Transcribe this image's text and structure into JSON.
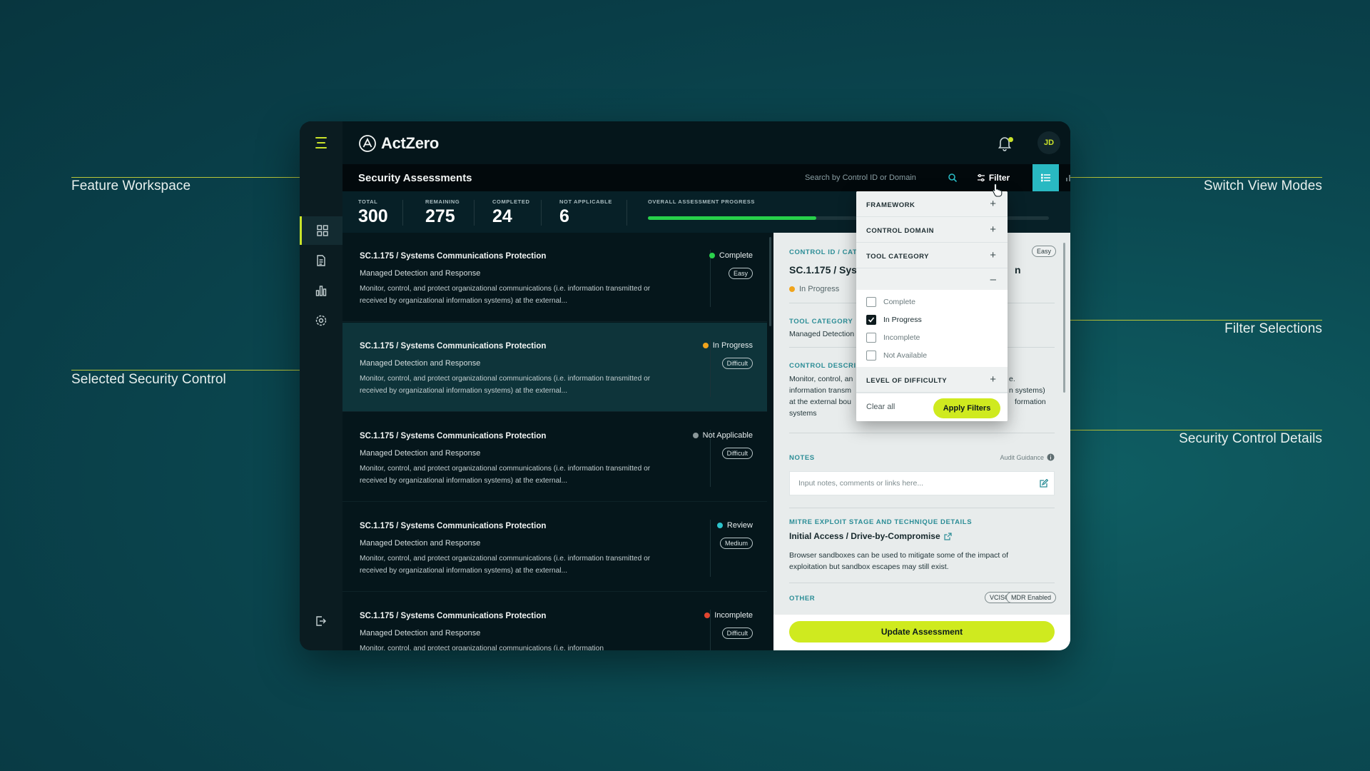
{
  "annotations": {
    "feature_workspace": "Feature Workspace",
    "selected_control": "Selected Security Control",
    "switch_view": "Switch View Modes",
    "filter_selections": "Filter Selections",
    "control_details": "Security Control Details"
  },
  "app": {
    "brand": "ActZero",
    "avatar_initials": "JD",
    "page_title": "Security Assessments",
    "search_placeholder": "Search by Control ID or Domain",
    "filter_label": "Filter"
  },
  "stats": {
    "total": {
      "label": "TOTAL",
      "value": "300"
    },
    "remaining": {
      "label": "REMAINING",
      "value": "275"
    },
    "completed": {
      "label": "COMPLETED",
      "value": "24"
    },
    "not_applicable": {
      "label": "NOT APPLICABLE",
      "value": "6"
    },
    "progress_label": "OVERALL ASSESSMENT PROGRESS",
    "progress_fraction": 0.42
  },
  "controls": [
    {
      "title": "SC.1.175 / Systems Communications Protection",
      "sub": "Managed Detection and Response",
      "desc": "Monitor, control, and protect organizational communications (i.e. information transmitted or received by organizational information systems) at the external...",
      "status": "Complete",
      "status_color": "#2ad24c",
      "difficulty": "Easy"
    },
    {
      "title": "SC.1.175 / Systems Communications Protection",
      "sub": "Managed Detection and Response",
      "desc": "Monitor, control, and protect organizational communications (i.e. information transmitted or received by organizational information systems) at the external...",
      "status": "In Progress",
      "status_color": "#f0a41c",
      "difficulty": "Difficult"
    },
    {
      "title": "SC.1.175 / Systems Communications Protection",
      "sub": "Managed Detection and Response",
      "desc": "Monitor, control, and protect organizational communications (i.e. information transmitted or received by organizational information systems) at the external...",
      "status": "Not Applicable",
      "status_color": "#8a9799",
      "difficulty": "Difficult"
    },
    {
      "title": "SC.1.175 / Systems Communications Protection",
      "sub": "Managed Detection and Response",
      "desc": "Monitor, control, and protect organizational communications (i.e. information transmitted or received by organizational information systems) at the external...",
      "status": "Review",
      "status_color": "#2cc2cb",
      "difficulty": "Medium"
    },
    {
      "title": "SC.1.175 / Systems Communications Protection",
      "sub": "Managed Detection and Response",
      "desc": "Monitor, control, and protect organizational communications (i.e. information",
      "status": "Incomplete",
      "status_color": "#e2452f",
      "difficulty": "Difficult"
    }
  ],
  "detail": {
    "control_id_label": "CONTROL ID / CAT",
    "difficulty": "Easy",
    "title": "SC.1.175 / Syste",
    "title_tail": "n",
    "status": "In Progress",
    "status_color": "#f0a41c",
    "tool_category_label": "TOOL CATEGORY",
    "tool_category": "Managed Detection",
    "control_desc_label": "CONTROL DESCRI",
    "desc_line1": "Monitor, control, an",
    "desc_line1_tail": "e.",
    "desc_line2": "information transm",
    "desc_line2_tail": "n systems)",
    "desc_line3": "at the external bou",
    "desc_line3_tail": "formation",
    "desc_line4": "systems",
    "notes_label": "NOTES",
    "audit_guidance": "Audit Guidance",
    "notes_placeholder": "Input notes, comments or links here...",
    "mitre_label": "MITRE EXPLOIT STAGE AND TECHNIQUE DETAILS",
    "mitre_title": "Initial Access / Drive-by-Compromise",
    "mitre_desc1": "Browser sandboxes can be used to mitigate some of the impact of",
    "mitre_desc2": "exploitation but sandbox escapes may still exist.",
    "other_label": "OTHER",
    "tag1": "VCISO",
    "tag2": "MDR Enabled",
    "update_button": "Update Assessment"
  },
  "filter_dropdown": {
    "framework": "FRAMEWORK",
    "control_domain": "CONTROL DOMAIN",
    "tool_category": "TOOL CATEGORY",
    "level_of_difficulty": "LEVEL OF DIFFICULTY",
    "options": [
      {
        "label": "Complete",
        "checked": false
      },
      {
        "label": "In Progress",
        "checked": true
      },
      {
        "label": "Incomplete",
        "checked": false
      },
      {
        "label": "Not Available",
        "checked": false
      }
    ],
    "clear_all": "Clear all",
    "apply": "Apply Filters"
  }
}
